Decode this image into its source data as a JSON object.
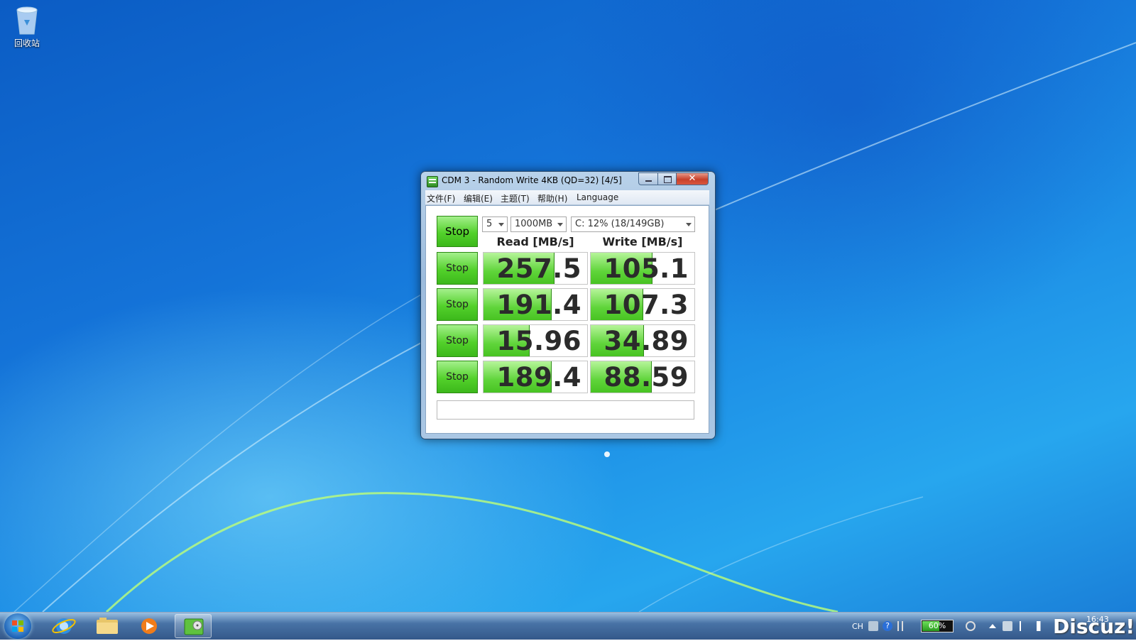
{
  "desktop": {
    "recycle_bin_label": "回收站"
  },
  "window": {
    "title": "CDM 3 - Random Write 4KB (QD=32) [4/5]",
    "close_label": "✕",
    "menu": [
      "文件(F)",
      "编辑(E)",
      "主题(T)",
      "帮助(H)",
      "Language"
    ]
  },
  "controls": {
    "all_button": "Stop",
    "runs": "5",
    "size": "1000MB",
    "drive": "C: 12% (18/149GB)"
  },
  "headers": {
    "read": "Read [MB/s]",
    "write": "Write [MB/s]"
  },
  "rows": [
    {
      "button": "Stop",
      "read": "257.5",
      "write": "105.1",
      "read_fill": 0.68,
      "write_fill": 0.59
    },
    {
      "button": "Stop",
      "read": "191.4",
      "write": "107.3",
      "read_fill": 0.65,
      "write_fill": 0.5
    },
    {
      "button": "Stop",
      "read": "15.96",
      "write": "34.89",
      "read_fill": 0.44,
      "write_fill": 0.51
    },
    {
      "button": "Stop",
      "read": "189.4",
      "write": "88.59",
      "read_fill": 0.65,
      "write_fill": 0.58
    }
  ],
  "status_text": "",
  "taskbar": {
    "lang": "CH",
    "battery_percent": "60%",
    "battery_level": 0.6,
    "clock_time": "16:43"
  },
  "watermark": "Discuz!"
}
